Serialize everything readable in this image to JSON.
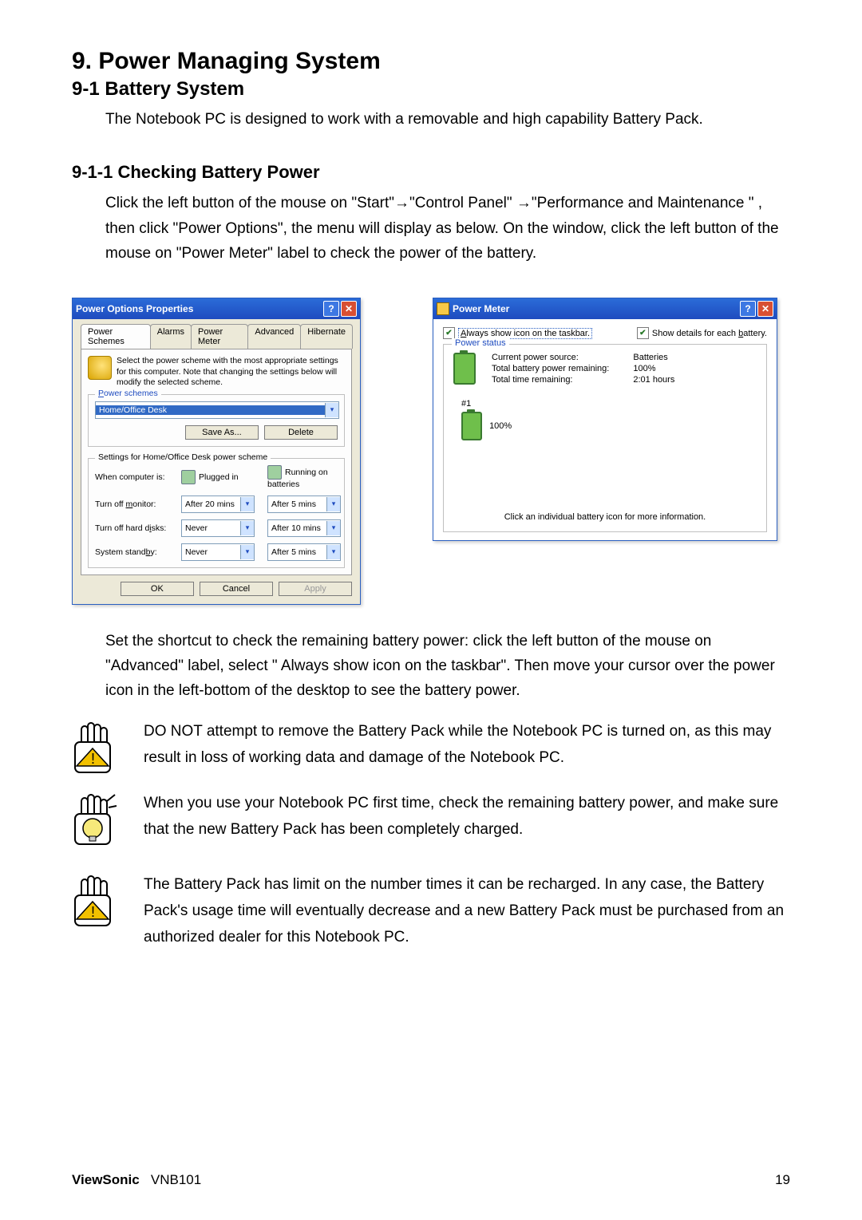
{
  "headings": {
    "h1": "9. Power Managing System",
    "h2": "9-1 Battery System",
    "h3": "9-1-1 Checking Battery Power"
  },
  "intro": "The Notebook PC is designed to work with a removable and high capability Battery Pack.",
  "checking_para": "Click the left button of the mouse on \"Start\"→\"Control Panel\"  →\"Performance and Maintenance \" , then click \"Power Options\", the menu will display as below. On the window, click the left button of the mouse on \"Power Meter\" label to check the power of the battery.",
  "set_shortcut": "Set the shortcut to check the remaining battery power: click the left button of the mouse on \"Advanced\" label, select \" Always show icon on the taskbar\". Then move your cursor over the power icon in the left-bottom of the desktop to see the battery power.",
  "notes": {
    "n1": "DO NOT attempt to remove the Battery Pack while the Notebook PC is turned on, as this may result in loss of working data and damage of the Notebook PC.",
    "n2": "When you use your Notebook PC first time, check the remaining battery power, and make sure that the new Battery Pack has been completely charged.",
    "n3": "The Battery Pack has limit on the number times it can be recharged. In any case, the Battery Pack's usage time will eventually decrease and a new Battery Pack must be purchased from an authorized dealer for this Notebook PC."
  },
  "footer": {
    "brand": "ViewSonic",
    "model": "VNB101",
    "page": "19"
  },
  "power_options": {
    "title": "Power Options Properties",
    "tabs": [
      "Power Schemes",
      "Alarms",
      "Power Meter",
      "Advanced",
      "Hibernate"
    ],
    "desc": "Select the power scheme with the most appropriate settings for this computer. Note that changing the settings below will modify the selected scheme.",
    "schemes_label": "Power schemes",
    "scheme_value": "Home/Office Desk",
    "save_as": "Save As...",
    "delete": "Delete",
    "settings_label": "Settings for Home/Office Desk power scheme",
    "when_computer": "When computer is:",
    "plugged_in": "Plugged in",
    "on_batt": "Running on batteries",
    "rows": {
      "monitor": "Turn off monitor:",
      "disks": "Turn off hard disks:",
      "standby": "System standby:"
    },
    "vals": {
      "mon_plug": "After 20 mins",
      "mon_batt": "After 5 mins",
      "disk_plug": "Never",
      "disk_batt": "After 10 mins",
      "stby_plug": "Never",
      "stby_batt": "After 5 mins"
    },
    "ok": "OK",
    "cancel": "Cancel",
    "apply": "Apply"
  },
  "power_meter": {
    "title": "Power Meter",
    "chk_taskbar": "Always show icon on the taskbar.",
    "chk_details": "Show details for each battery.",
    "group": "Power status",
    "source_lbl": "Current power source:",
    "source_val": "Batteries",
    "remain_lbl": "Total battery power remaining:",
    "remain_val": "100%",
    "time_lbl": "Total time remaining:",
    "time_val": "2:01 hours",
    "num": "#1",
    "pct": "100%",
    "foot": "Click an individual battery icon for more information."
  }
}
